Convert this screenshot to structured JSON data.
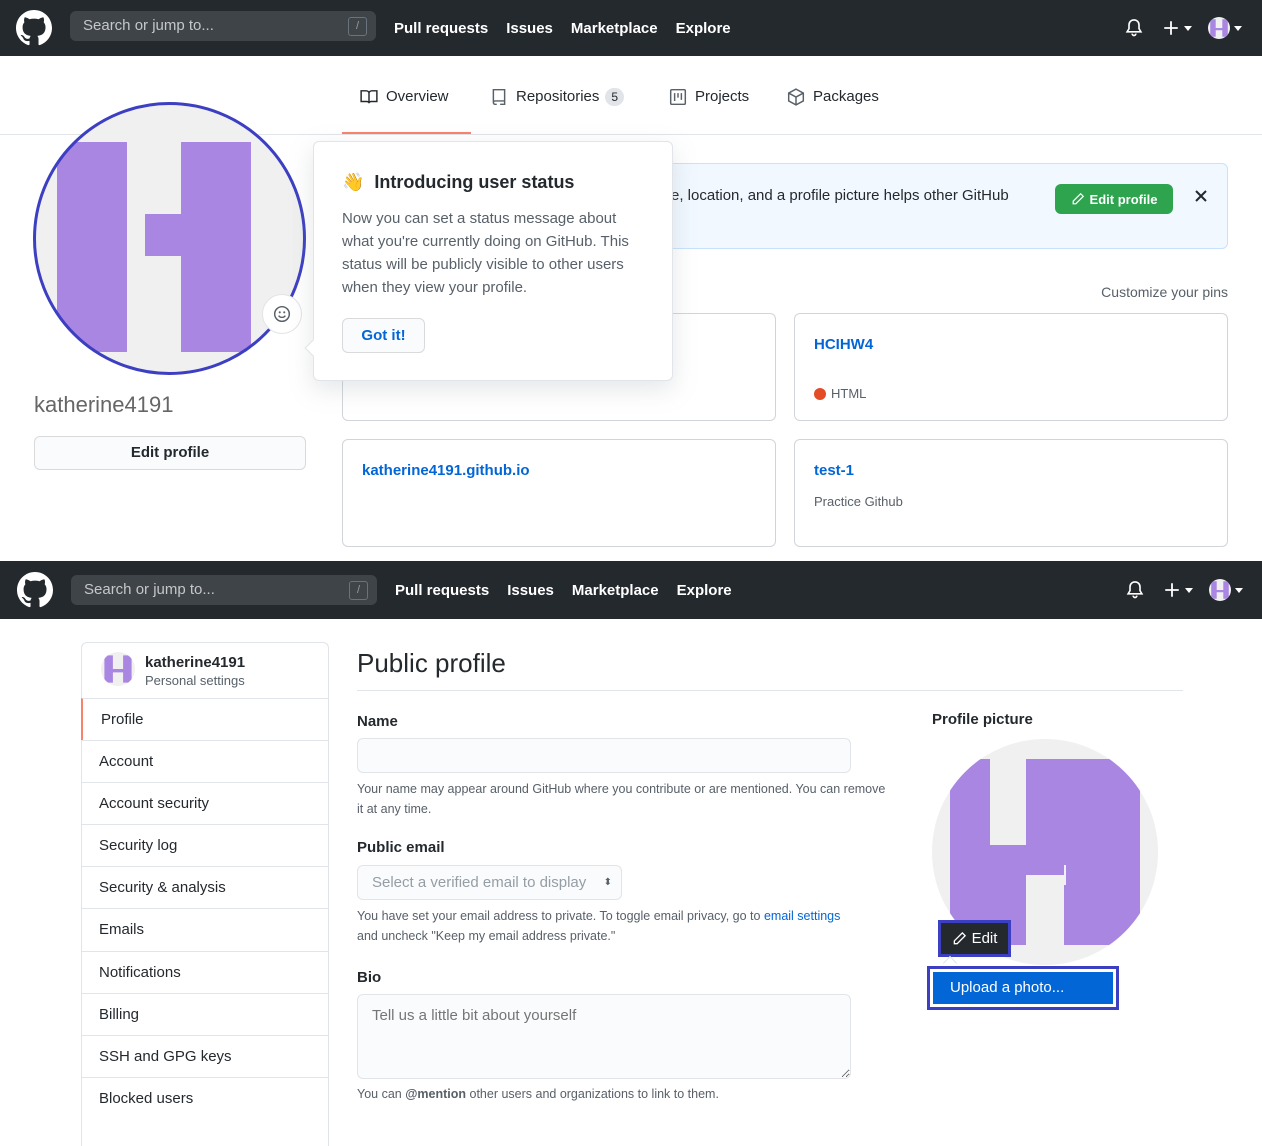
{
  "header": {
    "search_placeholder": "Search or jump to...",
    "slash_key": "/",
    "nav": [
      "Pull requests",
      "Issues",
      "Marketplace",
      "Explore"
    ]
  },
  "profile": {
    "tabs": [
      {
        "label": "Overview"
      },
      {
        "label": "Repositories",
        "count": "5"
      },
      {
        "label": "Projects"
      },
      {
        "label": "Packages"
      }
    ],
    "username": "katherine4191",
    "edit_profile_label": "Edit profile",
    "banner_text": "e, location, and a profile picture helps other GitHub",
    "banner_button": "Edit profile",
    "customize_pins": "Customize your pins",
    "popover": {
      "emoji": "👋",
      "title": "Introducing user status",
      "body": "Now you can set a status message about what you're currently doing on GitHub. This status will be publicly visible to other users when they view your profile.",
      "button": "Got it!"
    },
    "pinned": [
      {
        "name": "HCIHW4",
        "language": "HTML",
        "lang_color": "#e34c26"
      },
      {
        "name": "katherine4191.github.io"
      },
      {
        "name": "test-1",
        "description": "Practice Github"
      }
    ]
  },
  "settings": {
    "user": "katherine4191",
    "subtitle": "Personal settings",
    "menu": [
      "Profile",
      "Account",
      "Account security",
      "Security log",
      "Security & analysis",
      "Emails",
      "Notifications",
      "Billing",
      "SSH and GPG keys",
      "Blocked users"
    ],
    "title": "Public profile",
    "name_label": "Name",
    "name_note": "Your name may appear around GitHub where you contribute or are mentioned. You can remove it at any time.",
    "email_label": "Public email",
    "email_placeholder": "Select a verified email to display",
    "email_note_prefix": "You have set your email address to private. To toggle email privacy, go to ",
    "email_note_link": "email settings",
    "email_note_suffix": "and uncheck \"Keep my email address private.\"",
    "bio_label": "Bio",
    "bio_placeholder": "Tell us a little bit about yourself",
    "bio_note_prefix": "You can ",
    "bio_note_mention": "@mention",
    "bio_note_suffix": " other users and organizations to link to them.",
    "picture_label": "Profile picture",
    "edit_label": "Edit",
    "upload_label": "Upload a photo..."
  },
  "colors": {
    "accent": "#0366d6",
    "purple": "#a986e1",
    "green": "#2ea44f",
    "highlight": "#3c3fc2"
  }
}
